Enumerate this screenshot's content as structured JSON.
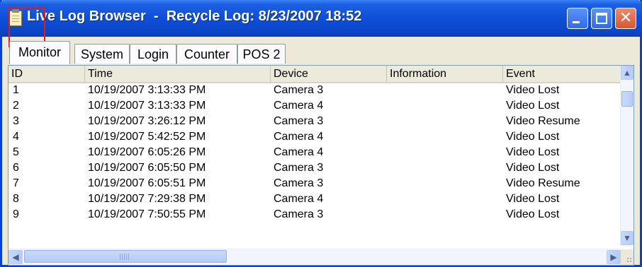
{
  "window": {
    "title": "Live Log Browser  -  Recycle Log: 8/23/2007 18:52",
    "icon": "clipboard-icon",
    "titlebar_color": "#0e4fd8",
    "highlight_color": "#e01b1b"
  },
  "tabs": [
    {
      "label": "Monitor",
      "active": true
    },
    {
      "label": "System",
      "active": false
    },
    {
      "label": "Login",
      "active": false
    },
    {
      "label": "Counter",
      "active": false
    },
    {
      "label": "POS 2",
      "active": false
    }
  ],
  "table": {
    "columns": [
      "ID",
      "Time",
      "Device",
      "Information",
      "Event"
    ],
    "rows": [
      [
        "1",
        "10/19/2007 3:13:33 PM",
        "Camera 3",
        "",
        "Video Lost"
      ],
      [
        "2",
        "10/19/2007 3:13:33 PM",
        "Camera 4",
        "",
        "Video Lost"
      ],
      [
        "3",
        "10/19/2007 3:26:12 PM",
        "Camera 3",
        "",
        "Video Resume"
      ],
      [
        "4",
        "10/19/2007 5:42:52 PM",
        "Camera 4",
        "",
        "Video Lost"
      ],
      [
        "5",
        "10/19/2007 6:05:26 PM",
        "Camera 4",
        "",
        "Video Lost"
      ],
      [
        "6",
        "10/19/2007 6:05:50 PM",
        "Camera 3",
        "",
        "Video Lost"
      ],
      [
        "7",
        "10/19/2007 6:05:51 PM",
        "Camera 3",
        "",
        "Video Resume"
      ],
      [
        "8",
        "10/19/2007 7:29:38 PM",
        "Camera 4",
        "",
        "Video Lost"
      ],
      [
        "9",
        "10/19/2007 7:50:55 PM",
        "Camera 3",
        "",
        "Video Lost"
      ]
    ]
  }
}
